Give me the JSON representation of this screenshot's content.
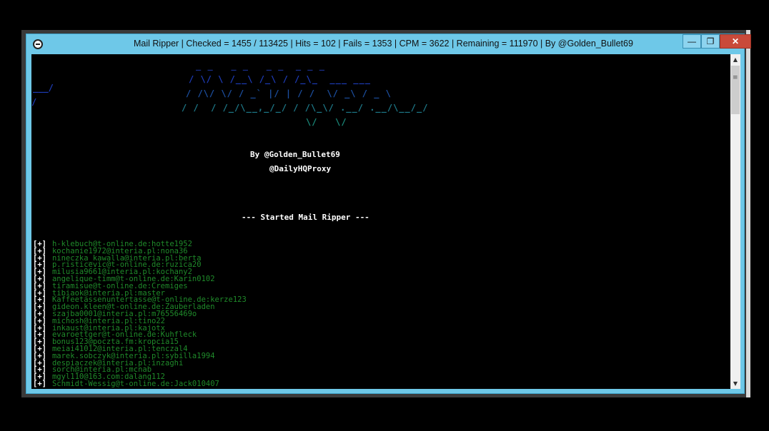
{
  "window": {
    "title": "Mail Ripper  | Checked = 1455 / 113425  | Hits = 102  | Fails = 1353  | CPM = 3622  | Remaining = 111970  | By @Golden_Bullet69",
    "minimize_label": "—",
    "maximize_label": "❐",
    "close_label": "✕"
  },
  "scrollbar": {
    "up": "▲",
    "down": "▼",
    "grip": "≡"
  },
  "banner": {
    "line1": "_ _   _ _   _ _  _ _ _",
    "line2": "/ \\/ \\ /__\\ /_\\ / /_\\_  ___ ___",
    "line3": "/ /\\/ \\/ / _` |/ | / /  \\/ _\\ / _ \\",
    "line4": "/ /  / /_/\\__,_/_/ / /\\_\\/ .__/ .__/\\__/_/",
    "line5": "\\/   \\/",
    "left1": "___/",
    "left2": "/"
  },
  "by_line": "By @Golden_Bullet69",
  "channel": "@DailyHQProxy",
  "started": "--- Started Mail Ripper ---",
  "log": {
    "tag": "[+]",
    "entries": [
      "h-klebuch@t-online.de:hotte1952",
      "kochanie1972@interia.pl:nona36",
      "nineczka_kawalla@interia.pl:berta",
      "p.risticevic@t-online.de:ruzica20",
      "milusia9661@interia.pl:kochany2",
      "angelique-timm@t-online.de:Karin0102",
      "tiramisue@t-online.de:Cremiges",
      "tibiaok@interia.pl:master",
      "Kaffeetassenuntertasse@t-online.de:kerze123",
      "gideon.kleen@t-online.de:Zauberladen",
      "szajba0001@interia.pl:m76556469o",
      "michosh@interia.pl:tino22",
      "inkaust@interia.pl:kajotx",
      "evaroettger@t-online.de:Kuhfleck",
      "bonus123@poczta.fm:kropcia15",
      "meiai41012@interia.pl:tenczal4",
      "marek.sobczyk@interia.pl:sybilla1994",
      "despiaczek@interia.pl:inzaghi",
      "sorch@interia.pl:mcnab",
      "mgyl110@163.com:dalang112",
      "Schmidt-Wessig@t-online.de:Jack010407"
    ]
  }
}
